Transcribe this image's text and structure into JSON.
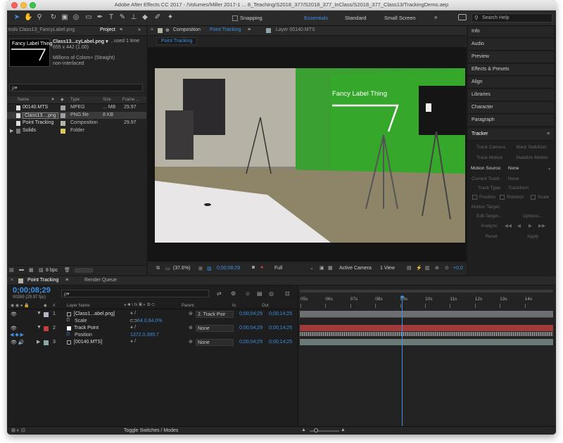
{
  "window": {
    "title": "Adobe After Effects CC 2017 - /Volumes/Miller 2017-1 ... 8_Teaching/S2018_377/S2018_377_InClass/S2018_377_Class13/TrackingDemo.aep"
  },
  "toolbar": {
    "snapping": "Snapping",
    "workspaces": [
      "Essentials",
      "Standard",
      "Small Screen"
    ],
    "search_placeholder": "Search Help"
  },
  "project": {
    "left_tab": "trols Class13_FancyLabel.png",
    "tab": "Project",
    "item_name": "Class13...cyLabel.png ▾",
    "used": ", used 1 time",
    "dims": "655 x 442 (1.00)",
    "colors": "Millions of Colors+ (Straight)",
    "interlace": "non-interlaced",
    "thumb_text": "Fancy Label Thing",
    "search_glyph": "ρ▾",
    "columns": {
      "name": "Name",
      "type": "Type",
      "size": "Size",
      "frame": "Frame ..."
    },
    "items": [
      {
        "name": "00140.MTS",
        "type": "MPEG",
        "size": "... MB",
        "frame": "29.97",
        "color": "#a0a0a0"
      },
      {
        "name": "Class13....png",
        "type": "PNG file",
        "size": "8 KB",
        "frame": "",
        "color": "#a0a0a0"
      },
      {
        "name": "Point Tracking",
        "type": "Composition",
        "size": "",
        "frame": "29.97",
        "color": "#b5b5a6"
      },
      {
        "name": "Solids",
        "type": "Folder",
        "size": "",
        "frame": "",
        "color": "#d9c85a"
      }
    ],
    "bpc": "8 bpc"
  },
  "viewer": {
    "tab_prefix": "Composition",
    "tab_name": "Point Tracking",
    "layer_tab": "Layer 00140.MTS",
    "subtab": "Point Tracking",
    "label_text": "Fancy Label Thing",
    "zoom": "(37.6%)",
    "timecode": "0;00;08;29",
    "resolution": "Full",
    "camera": "Active Camera",
    "view": "1 View",
    "offset": "+0.0"
  },
  "right": {
    "panels": [
      "Info",
      "Audio",
      "Preview",
      "Effects & Presets",
      "Align",
      "Libraries",
      "Character",
      "Paragraph"
    ],
    "tracker": {
      "title": "Tracker",
      "track_camera": "Track Camera",
      "warp": "Warp Stabilizer",
      "track_motion": "Track Motion",
      "stabilize": "Stabilize Motion",
      "motion_source_label": "Motion Source:",
      "motion_source": "None",
      "current_track_label": "Current Track:",
      "current_track": "None",
      "track_type_label": "Track Type:",
      "track_type": "Transform",
      "position": "Position",
      "rotation": "Rotation",
      "scale": "Scale",
      "motion_target": "Motion Target:",
      "edit_target": "Edit Target...",
      "options": "Options...",
      "analyze": "Analyze:",
      "reset": "Reset",
      "apply": "Apply"
    }
  },
  "timeline": {
    "tab": "Point Tracking",
    "render_queue": "Render Queue",
    "timecode": "0;00;08;29",
    "fps_info": "00269 (29.97 fps)",
    "search_glyph": "ρ▾",
    "columns": {
      "num": "#",
      "layer_name": "Layer Name",
      "parent": "Parent",
      "in": "In",
      "out": "Out"
    },
    "ruler": [
      "05s",
      "06s",
      "07s",
      "08s",
      "09s",
      "10s",
      "11s",
      "12s",
      "13s",
      "14s"
    ],
    "playhead_fraction": 0.4,
    "layers": [
      {
        "num": "1",
        "name": "[Class1...abel.png]",
        "parent": "2. Track Poir",
        "in": "0;00;04;29",
        "out": "0;00;14;25",
        "label_color": "#b5b5c8",
        "bar_color": "#6d6f73"
      },
      {
        "prop_name": "Scale",
        "prop_value": "64.0,64.0%"
      },
      {
        "num": "2",
        "name": "Track Point",
        "parent": "None",
        "in": "0;00;04;29",
        "out": "0;00;14;25",
        "label_color": "#c33d3d",
        "bar_color": "#a13b3b"
      },
      {
        "prop_name": "Position",
        "prop_value": "1372.0,399.7"
      },
      {
        "num": "3",
        "name": "[00140.MTS]",
        "parent": "None",
        "in": "0;00;04;29",
        "out": "0;00;14;25",
        "label_color": "#8aa6a6",
        "bar_color": "#6b7a78"
      }
    ],
    "toggle": "Toggle Switches / Modes"
  }
}
